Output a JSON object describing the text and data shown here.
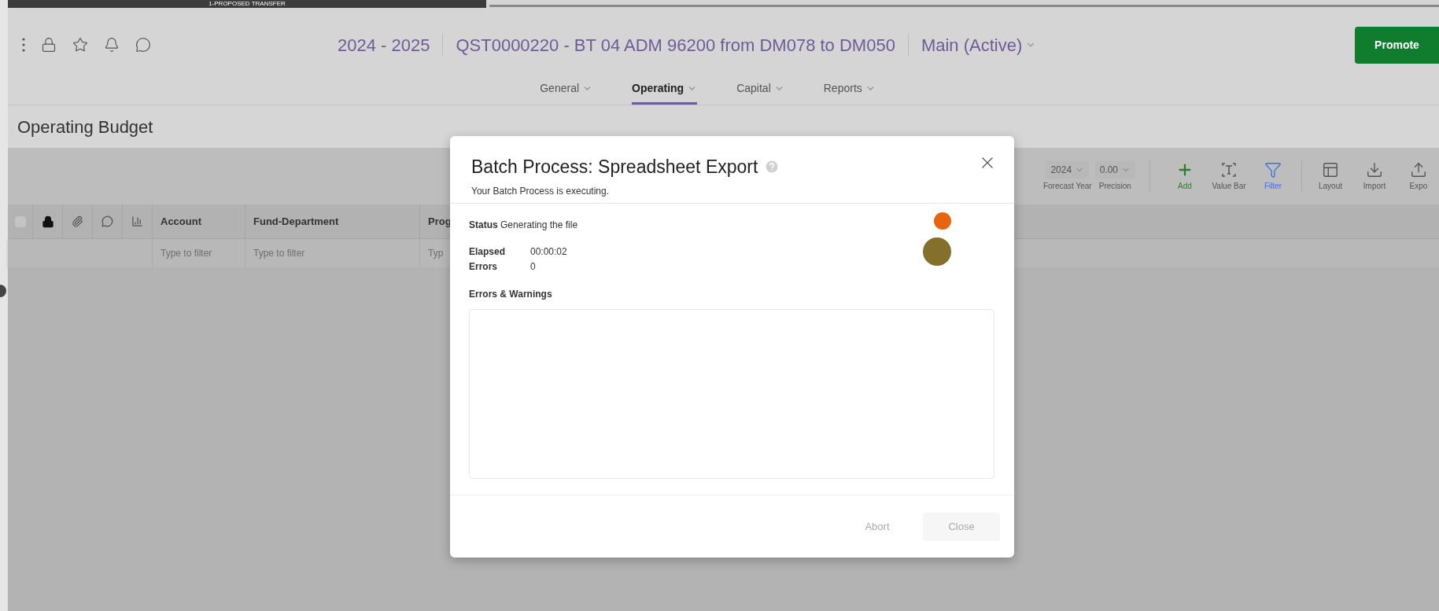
{
  "progress_banner": {
    "label": "1-PROPOSED TRANSFER"
  },
  "header": {
    "fiscal_year": "2024 - 2025",
    "title": "QST0000220 - BT 04 ADM 96200 from DM078 to DM050",
    "scenario": "Main (Active)",
    "promote_button": "Promote"
  },
  "nav_tabs": [
    {
      "label": "General",
      "selected": false
    },
    {
      "label": "Operating",
      "selected": true
    },
    {
      "label": "Capital",
      "selected": false
    },
    {
      "label": "Reports",
      "selected": false
    }
  ],
  "page_title": "Operating Budget",
  "toolbar": {
    "dropdowns": [
      {
        "value": "2024",
        "label": "Forecast Year"
      },
      {
        "value": "0.00",
        "label": "Precision"
      }
    ],
    "actions": [
      {
        "kind": "add",
        "label": "Add",
        "selected": false
      },
      {
        "kind": "value_bar",
        "label": "Value Bar",
        "selected": false
      },
      {
        "kind": "filter",
        "label": "Filter",
        "selected": true
      },
      {
        "kind": "layout",
        "label": "Layout",
        "selected": false
      },
      {
        "kind": "import",
        "label": "Import",
        "selected": false
      },
      {
        "kind": "export",
        "label": "Expo",
        "selected": false
      }
    ]
  },
  "table": {
    "select_all": {
      "checked": false
    },
    "columns": [
      {
        "label": "Account",
        "filter_placeholder": "Type to filter"
      },
      {
        "label": "Fund-Department",
        "filter_placeholder": "Type to filter"
      },
      {
        "label": "Prog",
        "filter_placeholder": "Typ"
      }
    ]
  },
  "dialog": {
    "title": "Batch Process: Spreadsheet Export",
    "subtitle": "Your Batch Process is executing.",
    "status": {
      "label": "Status",
      "value": "Generating the file"
    },
    "fields": [
      {
        "label": "Elapsed",
        "value": "00:00:02"
      },
      {
        "label": "Errors",
        "value": "0"
      }
    ],
    "log_label": "Errors & Warnings",
    "buttons": [
      {
        "label": "Abort",
        "disabled": true
      },
      {
        "label": "Close",
        "disabled": true
      }
    ]
  }
}
